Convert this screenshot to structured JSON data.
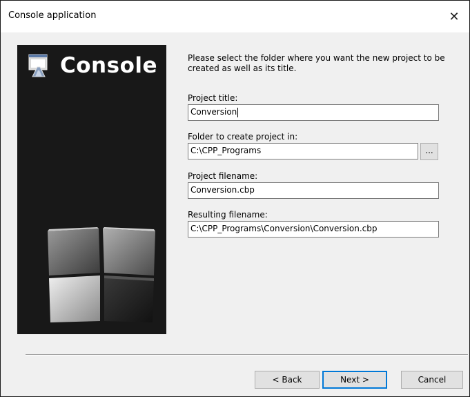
{
  "window": {
    "title": "Console application",
    "close_symbol": "✕"
  },
  "banner": {
    "title": "Console",
    "logo_icon": "console-window-icon",
    "art_icon": "cubes-icon"
  },
  "instructions": "Please select the folder where you want the new project to be created as well as its title.",
  "fields": {
    "project_title": {
      "label": "Project title:",
      "value": "Conversion"
    },
    "folder": {
      "label": "Folder to create project in:",
      "value": "C:\\CPP_Programs",
      "browse_label": "..."
    },
    "project_filename": {
      "label": "Project filename:",
      "value": "Conversion.cbp"
    },
    "resulting_filename": {
      "label": "Resulting filename:",
      "value": "C:\\CPP_Programs\\Conversion\\Conversion.cbp"
    }
  },
  "buttons": {
    "back": "< Back",
    "next": "Next >",
    "cancel": "Cancel"
  },
  "colors": {
    "banner_bg": "#181818",
    "default_button_border": "#0078d7",
    "dialog_bg": "#f0f0f0"
  }
}
